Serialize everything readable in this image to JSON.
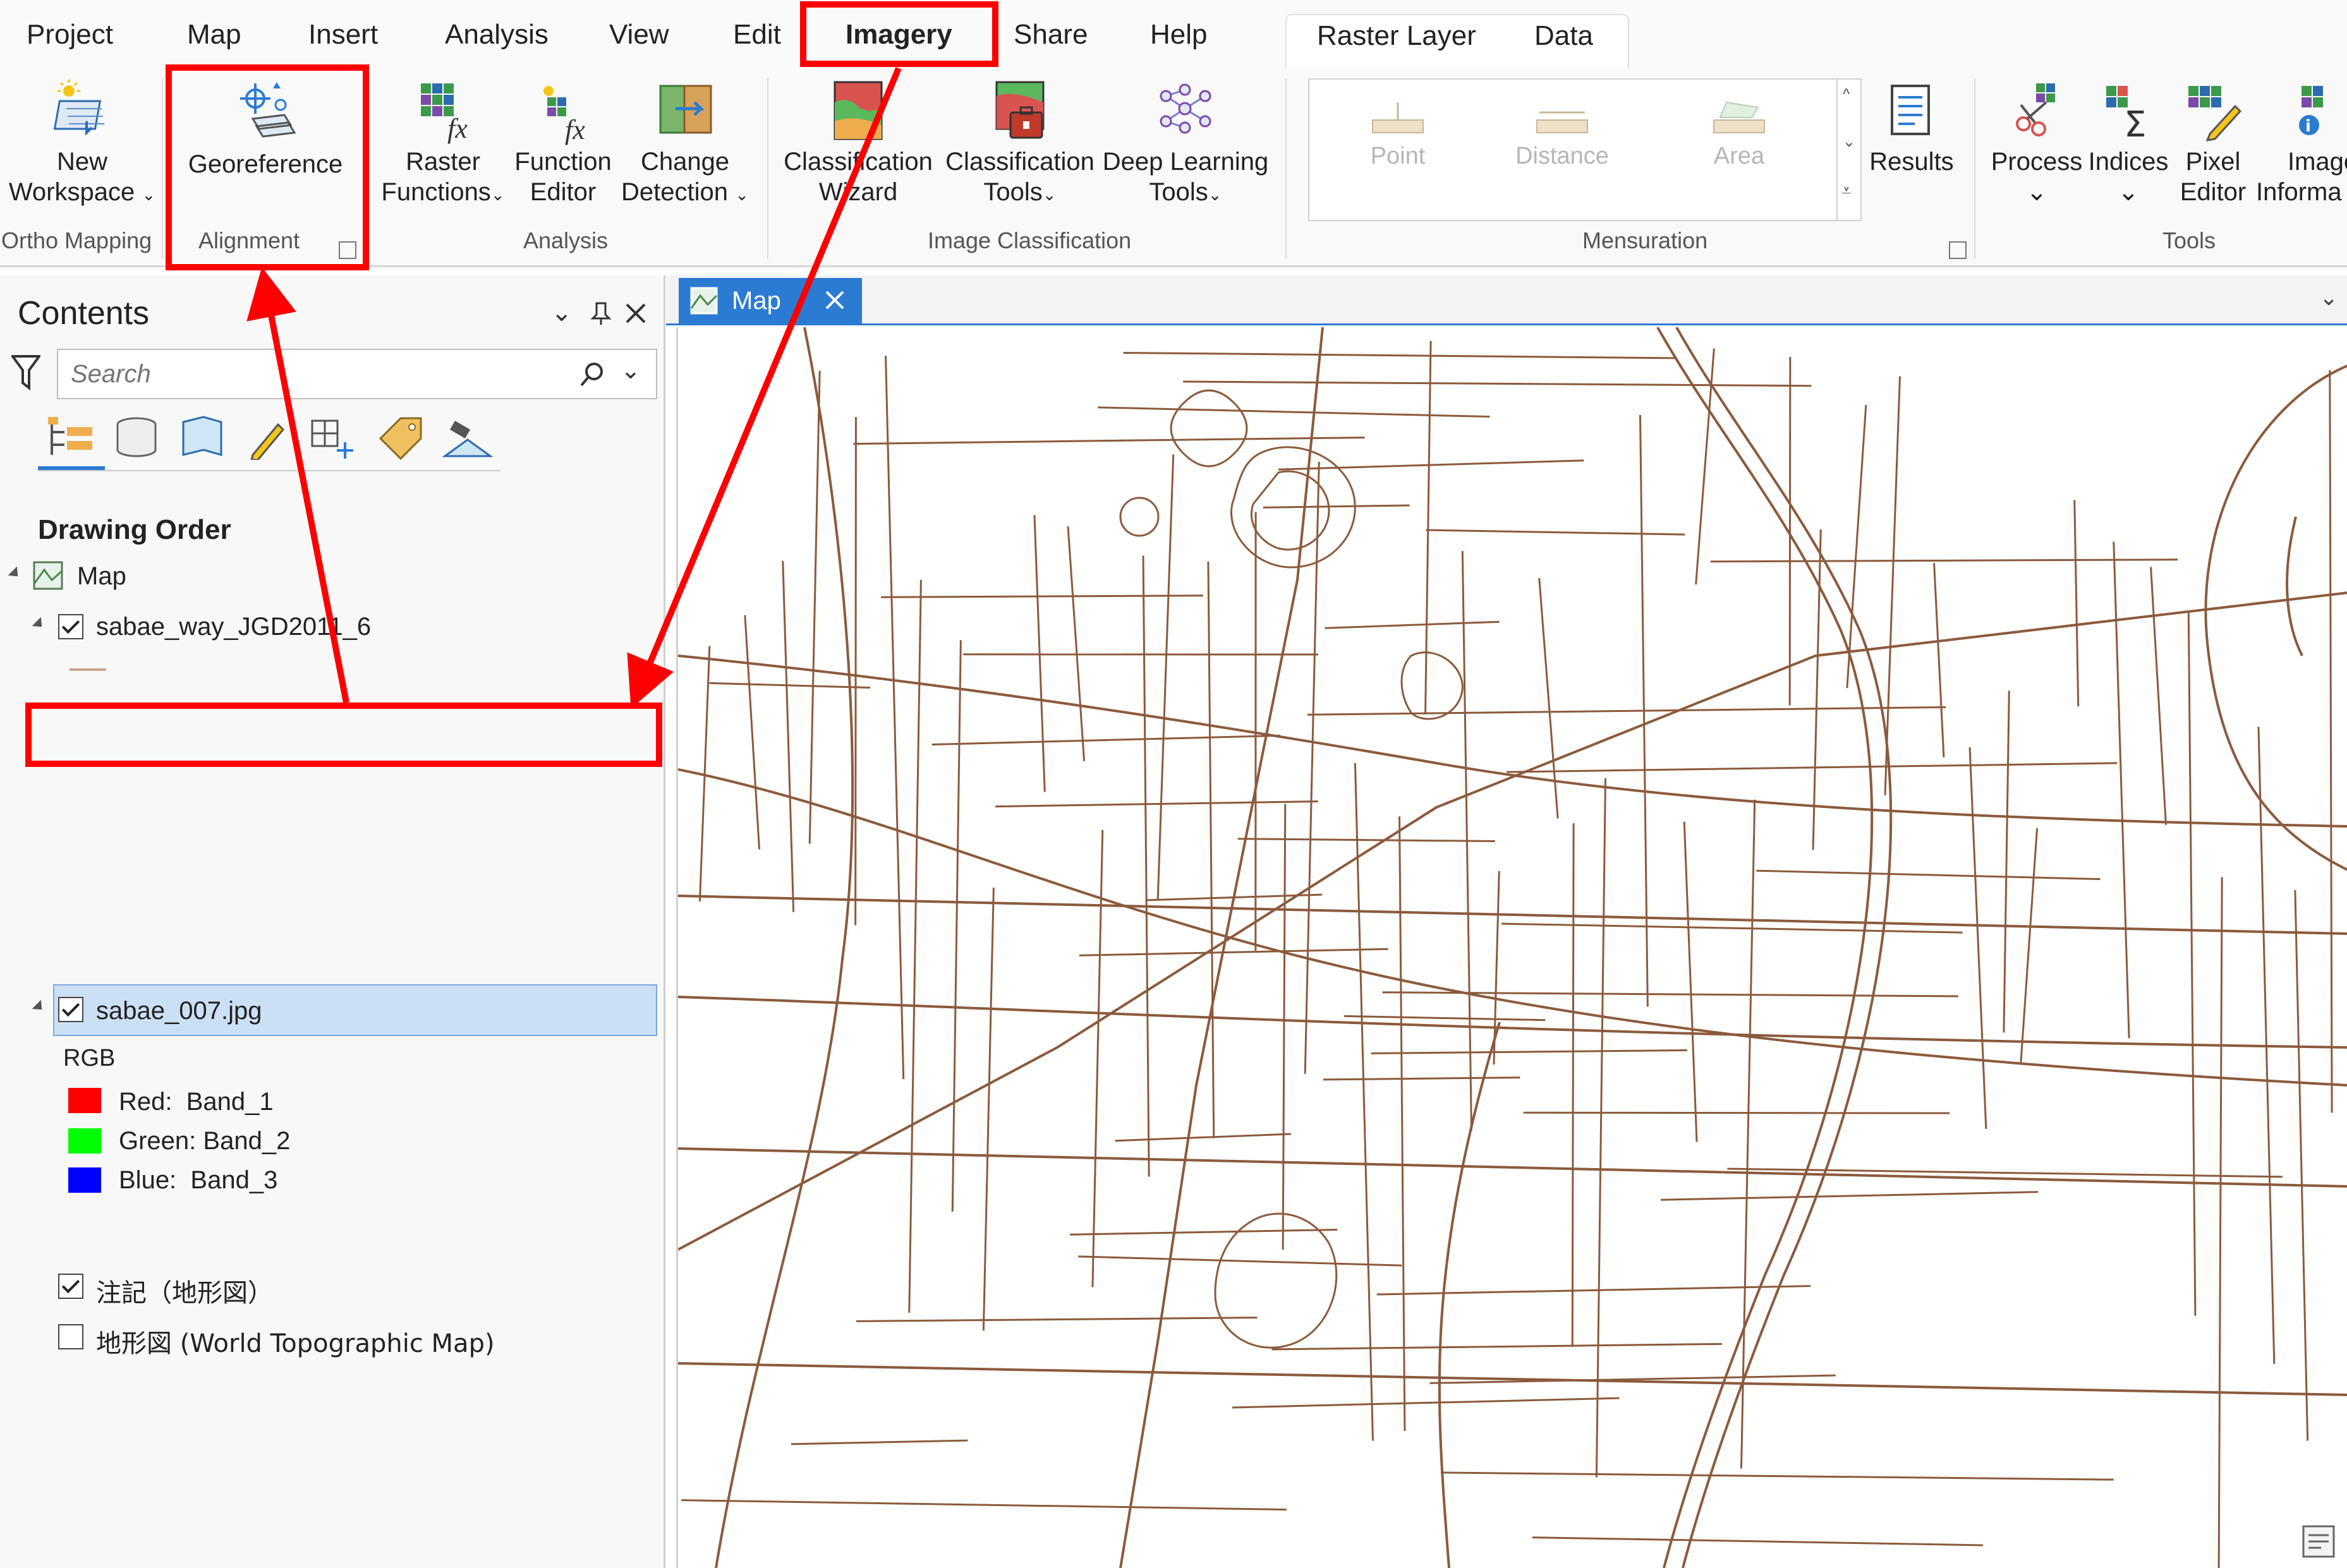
{
  "menu": {
    "tabs": [
      "Project",
      "Map",
      "Insert",
      "Analysis",
      "View",
      "Edit",
      "Imagery",
      "Share",
      "Help"
    ],
    "active_tab": "Imagery",
    "contextual_tabs": [
      "Raster Layer",
      "Data"
    ]
  },
  "ribbon": {
    "new_workspace": [
      "New",
      "Workspace"
    ],
    "georeference": "Georeference",
    "raster_functions": [
      "Raster",
      "Functions"
    ],
    "function_editor": [
      "Function",
      "Editor"
    ],
    "change_detection": [
      "Change",
      "Detection"
    ],
    "classification_wizard": [
      "Classification",
      "Wizard"
    ],
    "classification_tools": [
      "Classification",
      "Tools"
    ],
    "deep_learning_tools": [
      "Deep Learning",
      "Tools"
    ],
    "mensuration_items": [
      "Point",
      "Distance",
      "Area"
    ],
    "results": "Results",
    "process": "Process",
    "indices": "Indices",
    "pixel_editor": [
      "Pixel",
      "Editor"
    ],
    "image_information": [
      "Image",
      "Informa"
    ],
    "groups": {
      "ortho_mapping": "Ortho Mapping",
      "alignment": "Alignment",
      "analysis": "Analysis",
      "image_classification": "Image Classification",
      "mensuration": "Mensuration",
      "tools": "Tools"
    }
  },
  "contents": {
    "title": "Contents",
    "search_placeholder": "Search",
    "drawing_order": "Drawing Order",
    "map_label": "Map",
    "layers": [
      {
        "name": "sabae_way_JGD2011_6",
        "checked": true
      },
      {
        "name": "sabae_007.jpg",
        "checked": true,
        "selected": true
      },
      {
        "name": "注記（地形図）",
        "checked": true
      },
      {
        "name": "地形図 (World Topographic Map)",
        "checked": false
      }
    ],
    "renderer": "RGB",
    "bands": [
      {
        "label": "Red:  Band_1",
        "color": "#ff0000"
      },
      {
        "label": "Green: Band_2",
        "color": "#00ff00"
      },
      {
        "label": "Blue:  Band_3",
        "color": "#0000ff"
      }
    ]
  },
  "map_tab": {
    "label": "Map"
  },
  "colors": {
    "accent": "#2b7bd3",
    "highlight": "#ff0000",
    "road": "#8b5a3c",
    "selection": "#cce0f5"
  }
}
